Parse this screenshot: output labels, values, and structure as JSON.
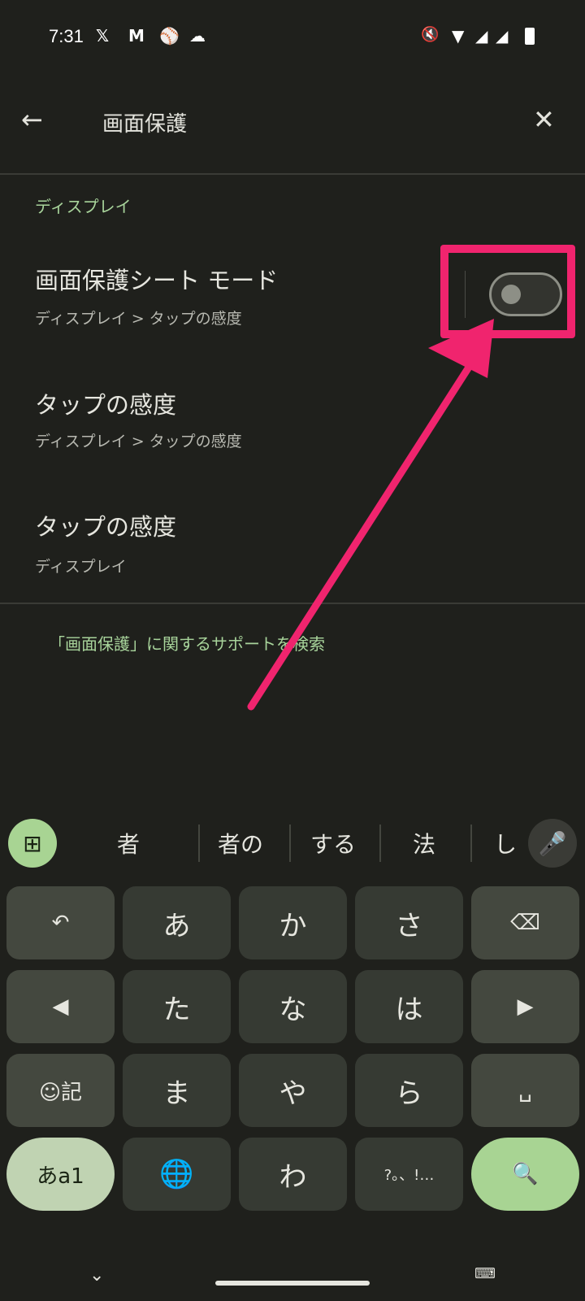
{
  "status_bar": {
    "time": "7:31",
    "notification_icons": [
      "x-icon",
      "gmail-icon",
      "baseball-icon",
      "cloud-icon"
    ],
    "system_icons": [
      "vibrate-off-icon",
      "wifi-icon",
      "signal-icon",
      "signal-icon",
      "battery-icon"
    ]
  },
  "header": {
    "search_query": "画面保護",
    "back_icon": "arrow-left-icon",
    "clear_icon": "close-icon"
  },
  "results": {
    "category": "ディスプレイ",
    "items": [
      {
        "title": "画面保護シート モード",
        "subtitle": "ディスプレイ > タップの感度",
        "toggle_on": false
      },
      {
        "title": "タップの感度",
        "subtitle": "ディスプレイ > タップの感度"
      },
      {
        "title": "タップの感度",
        "subtitle": "ディスプレイ"
      }
    ],
    "support_link": "「画面保護」に関するサポートを検索"
  },
  "annotation": {
    "color": "#f0246e"
  },
  "keyboard": {
    "suggestions": [
      "者",
      "者の",
      "する",
      "法",
      "し"
    ],
    "keys": [
      [
        "↶",
        "あ",
        "か",
        "さ",
        "⌫"
      ],
      [
        "◀",
        "た",
        "な",
        "は",
        "▶"
      ],
      [
        "☺記",
        "ま",
        "や",
        "ら",
        "␣"
      ],
      [
        "あa1",
        "🌐",
        "わ",
        "?。、!…",
        "🔍"
      ]
    ],
    "accent_color": "#a8d493"
  }
}
